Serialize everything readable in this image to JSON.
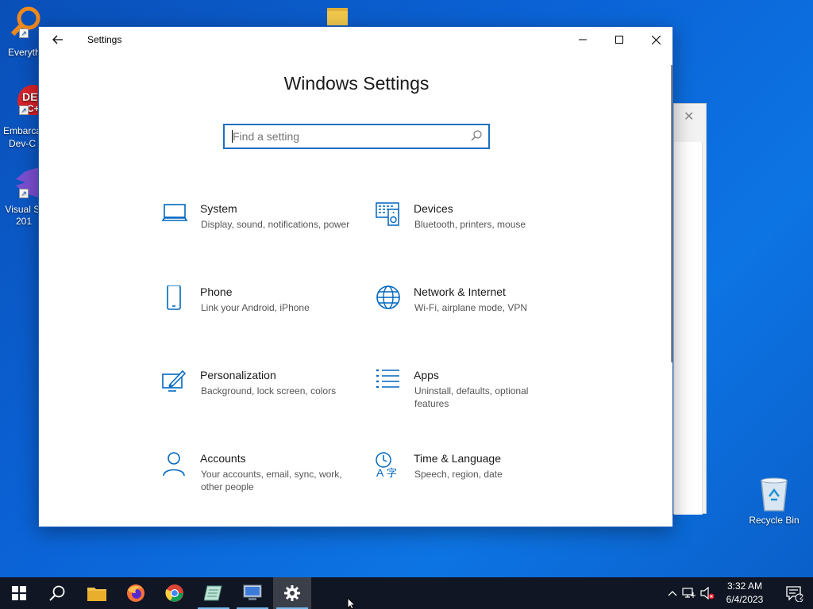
{
  "desktop": {
    "icons": [
      {
        "label": "Everyth",
        "icon": "everything-search-icon"
      },
      {
        "label": "Embarca Dev-C",
        "icon": "devcpp-icon"
      },
      {
        "label": "Visual St 201",
        "icon": "visual-studio-icon"
      }
    ],
    "recycle_bin": "Recycle Bin"
  },
  "window": {
    "title": "Settings",
    "heading": "Windows Settings",
    "search_placeholder": "Find a setting",
    "tiles": [
      {
        "name": "System",
        "desc": "Display, sound, notifications, power",
        "icon": "laptop-icon"
      },
      {
        "name": "Devices",
        "desc": "Bluetooth, printers, mouse",
        "icon": "devices-icon"
      },
      {
        "name": "Phone",
        "desc": "Link your Android, iPhone",
        "icon": "phone-icon"
      },
      {
        "name": "Network & Internet",
        "desc": "Wi-Fi, airplane mode, VPN",
        "icon": "globe-icon"
      },
      {
        "name": "Personalization",
        "desc": "Background, lock screen, colors",
        "icon": "paint-icon"
      },
      {
        "name": "Apps",
        "desc": "Uninstall, defaults, optional features",
        "icon": "apps-list-icon"
      },
      {
        "name": "Accounts",
        "desc": "Your accounts, email, sync, work, other people",
        "icon": "person-icon"
      },
      {
        "name": "Time & Language",
        "desc": "Speech, region, date",
        "icon": "time-language-icon"
      }
    ]
  },
  "taskbar": {
    "time": "3:32 AM",
    "date": "6/4/2023",
    "notification_count": "2"
  },
  "colors": {
    "accent": "#0067c0",
    "taskbar": "#101623",
    "desktop": "#0b63d6"
  }
}
